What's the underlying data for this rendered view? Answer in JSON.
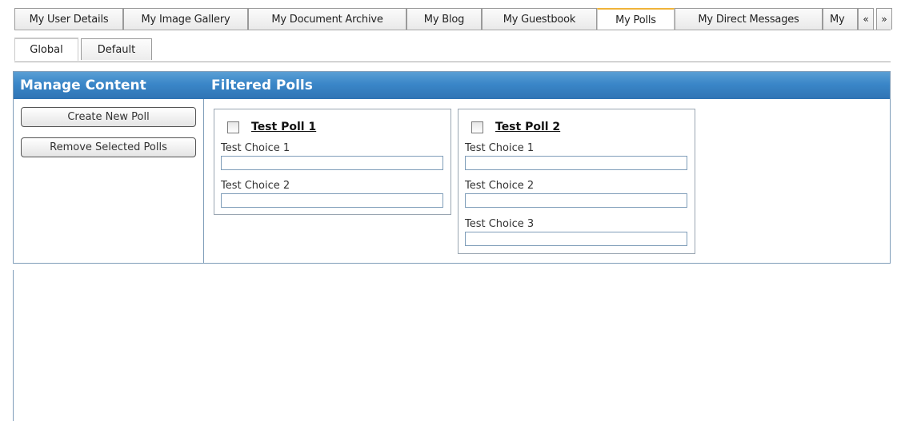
{
  "top_tabs": [
    {
      "label": "My User Details"
    },
    {
      "label": "My Image Gallery"
    },
    {
      "label": "My Document Archive"
    },
    {
      "label": "My Blog"
    },
    {
      "label": "My Guestbook"
    },
    {
      "label": "My Polls",
      "active": true
    },
    {
      "label": "My Direct Messages"
    },
    {
      "label": "My"
    }
  ],
  "scroll_buttons": {
    "prev": "«",
    "next": "»"
  },
  "sub_tabs": [
    {
      "label": "Global",
      "active": true
    },
    {
      "label": "Default"
    }
  ],
  "panel": {
    "left_title": "Manage Content",
    "right_title": "Filtered Polls",
    "buttons": {
      "create": "Create New Poll",
      "remove": "Remove Selected Polls"
    }
  },
  "polls": [
    {
      "title": "Test Poll 1",
      "checked": false,
      "choices": [
        "Test Choice 1",
        "Test Choice 2"
      ]
    },
    {
      "title": "Test Poll 2",
      "checked": false,
      "choices": [
        "Test Choice 1",
        "Test Choice 2",
        "Test Choice 3"
      ]
    }
  ],
  "colors": {
    "header_blue": "#3a86c8",
    "active_tab_accent": "#f0b43a",
    "border_blue": "#7f9db9"
  }
}
